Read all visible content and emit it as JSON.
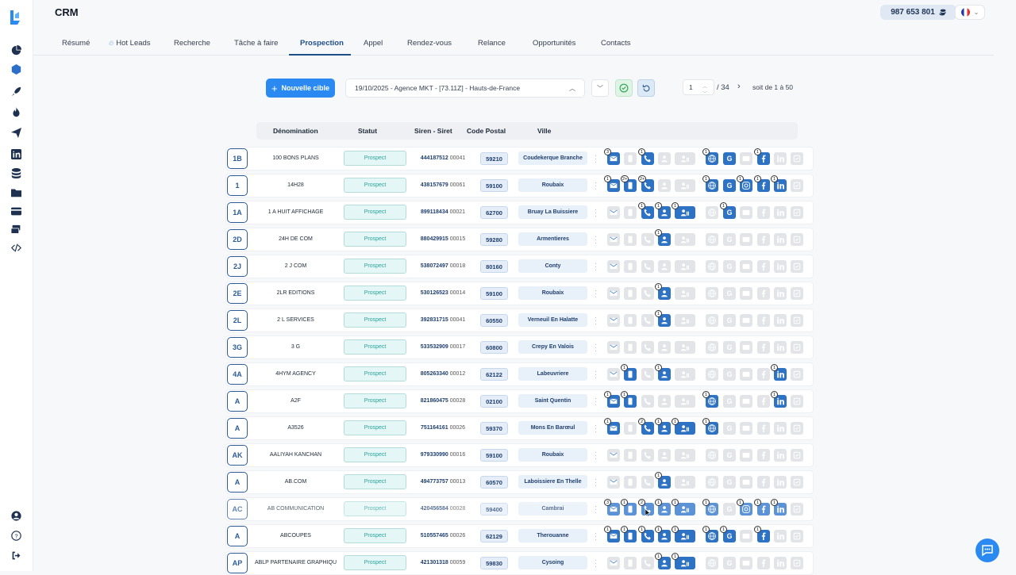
{
  "app": {
    "title": "CRM",
    "credits": "987 653 801"
  },
  "tabs": [
    "Résumé",
    "Hot Leads",
    "Recherche",
    "Tâche à faire",
    "Prospection",
    "Appel",
    "Rendez-vous",
    "Relance",
    "Opportunités",
    "Contacts"
  ],
  "active_tab": "Prospection",
  "toolbar": {
    "new_target_label": "Nouvelle cible",
    "target_value": "19/10/2025 - Agence MKT - [73.11Z] - Hauts-de-France",
    "page_value": "1",
    "page_total": "/ 34",
    "range_text": "soit de 1 à 50"
  },
  "columns": [
    "Dénomination",
    "Statut",
    "Siren - Siret",
    "Code Postal",
    "Ville"
  ],
  "channel_icons": [
    "email-icon",
    "mobile-icon",
    "phone-icon",
    "contact-icon",
    "linkedin-contact-icon",
    "website-icon",
    "google-icon",
    "list-icon",
    "instagram-icon",
    "facebook-icon",
    "linkedin-icon",
    "twitter-icon"
  ],
  "rows": [
    {
      "badge": "1B",
      "name": "100 BONS PLANS",
      "status": "Prospect",
      "siren": "444187512",
      "siret": "00041",
      "cp": "59210",
      "ville": "Coudekerque Branche",
      "active": {
        "email": 3,
        "phone": 1,
        "website": 1,
        "google": null,
        "facebook": 1
      }
    },
    {
      "badge": "1",
      "name": "14H28",
      "status": "Prospect",
      "siren": "438157679",
      "siret": "00061",
      "cp": "59100",
      "ville": "Roubaix",
      "active": {
        "email": 1,
        "mobile": "2+",
        "phone": "2+",
        "website": 1,
        "google": null,
        "instagram": 1,
        "facebook": 1,
        "linkedin": 1
      }
    },
    {
      "badge": "1A",
      "name": "1 A HUIT AFFICHAGE",
      "status": "Prospect",
      "siren": "899118434",
      "siret": "00021",
      "cp": "62700",
      "ville": "Bruay La Buissiere",
      "active": {
        "phone": 1,
        "contact": 1,
        "linkedin_contact": 1,
        "google": 1
      }
    },
    {
      "badge": "2D",
      "name": "24H DE COM",
      "status": "Prospect",
      "siren": "880429915",
      "siret": "00015",
      "cp": "59280",
      "ville": "Armentieres",
      "active": {
        "contact": 1
      }
    },
    {
      "badge": "2J",
      "name": "2 J COM",
      "status": "Prospect",
      "siren": "538072497",
      "siret": "00018",
      "cp": "80160",
      "ville": "Conty",
      "active": {}
    },
    {
      "badge": "2E",
      "name": "2LR EDITIONS",
      "status": "Prospect",
      "siren": "530126523",
      "siret": "00014",
      "cp": "59100",
      "ville": "Roubaix",
      "active": {
        "contact": 1
      }
    },
    {
      "badge": "2L",
      "name": "2 L SERVICES",
      "status": "Prospect",
      "siren": "392831715",
      "siret": "00041",
      "cp": "60550",
      "ville": "Verneuil En Halatte",
      "active": {
        "contact": 1
      }
    },
    {
      "badge": "3G",
      "name": "3 G",
      "status": "Prospect",
      "siren": "533532909",
      "siret": "00017",
      "cp": "60800",
      "ville": "Crepy En Valois",
      "active": {}
    },
    {
      "badge": "4A",
      "name": "4HYM AGENCY",
      "status": "Prospect",
      "siren": "805263340",
      "siret": "00012",
      "cp": "62122",
      "ville": "Labeuvriere",
      "active": {
        "mobile": 1,
        "contact": 1,
        "linkedin": 1
      }
    },
    {
      "badge": "A",
      "name": "A2F",
      "status": "Prospect",
      "siren": "821860475",
      "siret": "00028",
      "cp": "02100",
      "ville": "Saint Quentin",
      "active": {
        "email": 1,
        "mobile": 1,
        "website": 1,
        "linkedin": 1
      }
    },
    {
      "badge": "A",
      "name": "A3526",
      "status": "Prospect",
      "siren": "751164161",
      "siret": "00026",
      "cp": "59370",
      "ville": "Mons En Barœul",
      "active": {
        "email": 1,
        "phone": 2,
        "contact": 1,
        "linkedin_contact": 1,
        "website": 1
      }
    },
    {
      "badge": "AK",
      "name": "AALIYAH KANCHAN",
      "status": "Prospect",
      "siren": "979330990",
      "siret": "00016",
      "cp": "59100",
      "ville": "Roubaix",
      "active": {}
    },
    {
      "badge": "A",
      "name": "AB.COM",
      "status": "Prospect",
      "siren": "494773757",
      "siret": "00013",
      "cp": "60570",
      "ville": "Laboissiere En Thelle",
      "active": {
        "contact": 1
      }
    },
    {
      "badge": "AC",
      "name": "AB COMMUNICATION",
      "status": "Prospect",
      "siren": "420456584",
      "siret": "00028",
      "cp": "59400",
      "ville": "Cambrai",
      "active": {
        "email": 3,
        "mobile": 1,
        "phone": 2,
        "contact": 1,
        "linkedin_contact": 1,
        "website": 1,
        "instagram": 1,
        "facebook": 1,
        "linkedin": 1
      }
    },
    {
      "badge": "A",
      "name": "ABCOUPES",
      "status": "Prospect",
      "siren": "510557465",
      "siret": "00026",
      "cp": "62129",
      "ville": "Therouanne",
      "active": {
        "email": 1,
        "mobile": 1,
        "phone": 1,
        "contact": 1,
        "linkedin_contact": 1,
        "website": 1,
        "google": 1,
        "facebook": 1
      }
    },
    {
      "badge": "AP",
      "name": "ABLP PARTENAIRE GRAPHIQU",
      "status": "Prospect",
      "siren": "421301318",
      "siret": "00059",
      "cp": "59830",
      "ville": "Cysoing",
      "active": {
        "contact": 1,
        "linkedin_contact": 1
      }
    }
  ],
  "colors": {
    "primary": "#2b8af2",
    "active_icon": "#2e72c4",
    "inactive_icon": "#e2e4e8",
    "status_text": "#2aa39a",
    "nav_dark": "#1e3150"
  }
}
